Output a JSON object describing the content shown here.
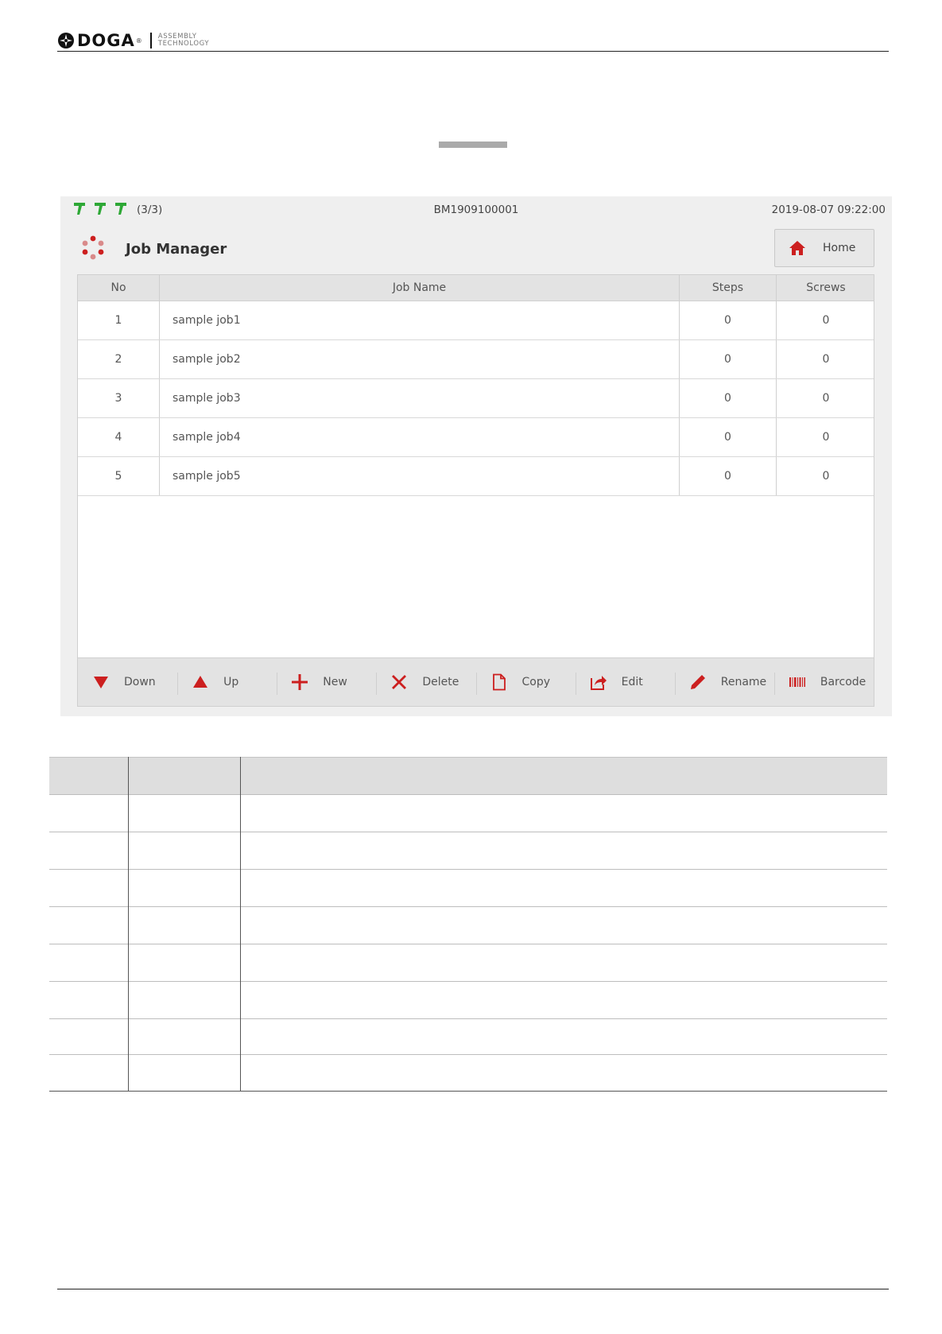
{
  "brand": {
    "logo_text": "DOGA",
    "tagline_line1": "ASSEMBLY",
    "tagline_line2": "TECHNOLOGY"
  },
  "status_bar": {
    "tool_icons": [
      "screwdriver-icon",
      "screwdriver-icon",
      "screwdriver-icon"
    ],
    "tool_count": "(3/3)",
    "serial": "BM1909100001",
    "datetime": "2019-08-07 09:22:00"
  },
  "header": {
    "title": "Job Manager",
    "home_label": "Home"
  },
  "job_table": {
    "columns": [
      "No",
      "Job Name",
      "Steps",
      "Screws"
    ],
    "rows": [
      {
        "no": "1",
        "name": "sample job1",
        "steps": "0",
        "screws": "0"
      },
      {
        "no": "2",
        "name": "sample job2",
        "steps": "0",
        "screws": "0"
      },
      {
        "no": "3",
        "name": "sample job3",
        "steps": "0",
        "screws": "0"
      },
      {
        "no": "4",
        "name": "sample job4",
        "steps": "0",
        "screws": "0"
      },
      {
        "no": "5",
        "name": "sample job5",
        "steps": "0",
        "screws": "0"
      }
    ]
  },
  "toolbar": [
    {
      "id": "down",
      "label": "Down",
      "icon": "triangle-down-icon"
    },
    {
      "id": "up",
      "label": "Up",
      "icon": "triangle-up-icon"
    },
    {
      "id": "new",
      "label": "New",
      "icon": "plus-icon"
    },
    {
      "id": "delete",
      "label": "Delete",
      "icon": "x-icon"
    },
    {
      "id": "copy",
      "label": "Copy",
      "icon": "document-icon"
    },
    {
      "id": "edit",
      "label": "Edit",
      "icon": "share-edit-icon"
    },
    {
      "id": "rename",
      "label": "Rename",
      "icon": "pencil-icon"
    },
    {
      "id": "barcode",
      "label": "Barcode",
      "icon": "barcode-icon"
    }
  ],
  "colors": {
    "accent_red": "#cc1f1f",
    "tool_green": "#2ea836",
    "panel_grey": "#efefef"
  }
}
